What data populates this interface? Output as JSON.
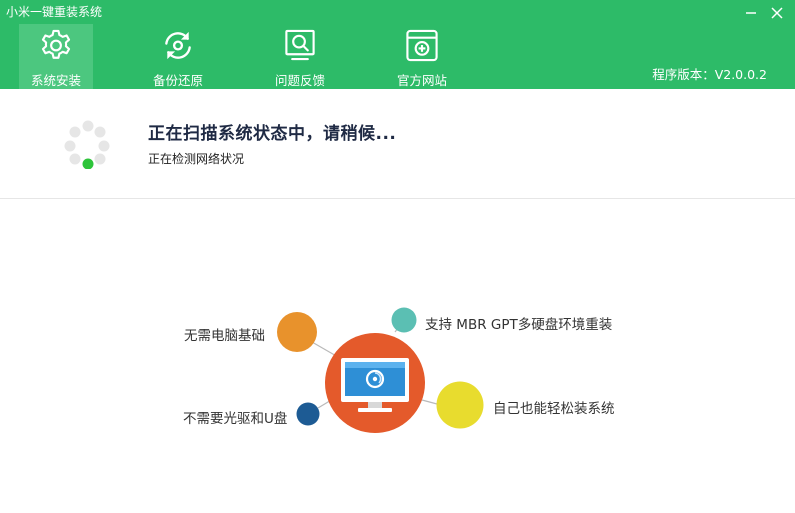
{
  "window": {
    "title": "小米一键重装系统"
  },
  "nav": {
    "tabs": [
      {
        "label": "系统安装",
        "icon": "gear-icon",
        "active": true
      },
      {
        "label": "备份还原",
        "icon": "refresh-icon",
        "active": false
      },
      {
        "label": "问题反馈",
        "icon": "feedback-icon",
        "active": false
      },
      {
        "label": "官方网站",
        "icon": "website-icon",
        "active": false
      }
    ]
  },
  "version": "程序版本：V2.0.0.2",
  "scan": {
    "title": "正在扫描系统状态中，请稍候...",
    "status": "正在检测网络状况"
  },
  "features": {
    "top_left": "无需电脑基础",
    "top_right": "支持 MBR GPT多硬盘环境重装",
    "bottom_left": "不需要光驱和U盘",
    "bottom_right": "自己也能轻松装系统"
  },
  "colors": {
    "brand_green": "#2dbb68",
    "orange": "#e8922c",
    "teal": "#5bbfb3",
    "navy": "#1d5b94",
    "yellow": "#e8dc2e",
    "center_red": "#e45a2b"
  }
}
